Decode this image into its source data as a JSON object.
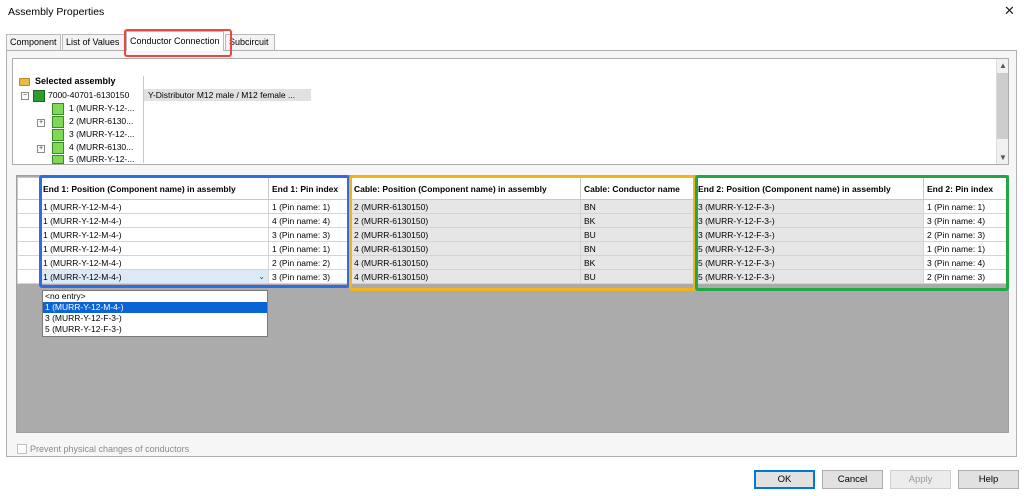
{
  "window": {
    "title": "Assembly Properties",
    "close_glyph": "✕"
  },
  "tabs": [
    {
      "label": "Component"
    },
    {
      "label": "List of Values"
    },
    {
      "label": "Conductor Connection"
    },
    {
      "label": "Subcircuit"
    }
  ],
  "tree": {
    "root_label": "Selected assembly",
    "assembly_label": "7000-40701-6130150",
    "assembly_description": "Y-Distributor M12 male / M12 female ...",
    "items": [
      {
        "label": "1 (MURR-Y-12-...",
        "expandable": false
      },
      {
        "label": "2 (MURR-6130...",
        "expandable": true
      },
      {
        "label": "3 (MURR-Y-12-...",
        "expandable": false
      },
      {
        "label": "4 (MURR-6130...",
        "expandable": true
      },
      {
        "label": "5 (MURR-Y-12-...",
        "expandable": false
      }
    ]
  },
  "grid": {
    "headers": [
      "End 1: Position (Component name) in assembly",
      "End 1: Pin index",
      "Cable: Position (Component name) in assembly",
      "Cable: Conductor name",
      "End 2: Position (Component name) in assembly",
      "End 2: Pin index"
    ],
    "rows": [
      [
        "1 (MURR-Y-12-M-4-)",
        "1 (Pin name: 1)",
        "2 (MURR-6130150)",
        "BN",
        "3 (MURR-Y-12-F-3-)",
        "1 (Pin name: 1)"
      ],
      [
        "1 (MURR-Y-12-M-4-)",
        "4 (Pin name: 4)",
        "2 (MURR-6130150)",
        "BK",
        "3 (MURR-Y-12-F-3-)",
        "3 (Pin name: 4)"
      ],
      [
        "1 (MURR-Y-12-M-4-)",
        "3 (Pin name: 3)",
        "2 (MURR-6130150)",
        "BU",
        "3 (MURR-Y-12-F-3-)",
        "2 (Pin name: 3)"
      ],
      [
        "1 (MURR-Y-12-M-4-)",
        "1 (Pin name: 1)",
        "4 (MURR-6130150)",
        "BN",
        "5 (MURR-Y-12-F-3-)",
        "1 (Pin name: 1)"
      ],
      [
        "1 (MURR-Y-12-M-4-)",
        "2 (Pin name: 2)",
        "4 (MURR-6130150)",
        "BK",
        "5 (MURR-Y-12-F-3-)",
        "3 (Pin name: 4)"
      ],
      [
        "1 (MURR-Y-12-M-4-)",
        "3 (Pin name: 3)",
        "4 (MURR-6130150)",
        "BU",
        "5 (MURR-Y-12-F-3-)",
        "2 (Pin name: 3)"
      ]
    ],
    "dropdown_options": [
      "<no entry>",
      "1 (MURR-Y-12-M-4-)",
      "3 (MURR-Y-12-F-3-)",
      "5 (MURR-Y-12-F-3-)"
    ],
    "dropdown_selected_index": 1
  },
  "footer": {
    "checkbox_label": "Prevent physical changes of conductors",
    "checkbox_checked": false,
    "buttons": {
      "ok": "OK",
      "cancel": "Cancel",
      "apply": "Apply",
      "help": "Help"
    }
  },
  "colors": {
    "highlight_tab": "#e64a3c",
    "highlight_end1": "#2e6be6",
    "highlight_cable": "#f0b51c",
    "highlight_end2": "#1fa845",
    "selection": "#0a64d6"
  }
}
